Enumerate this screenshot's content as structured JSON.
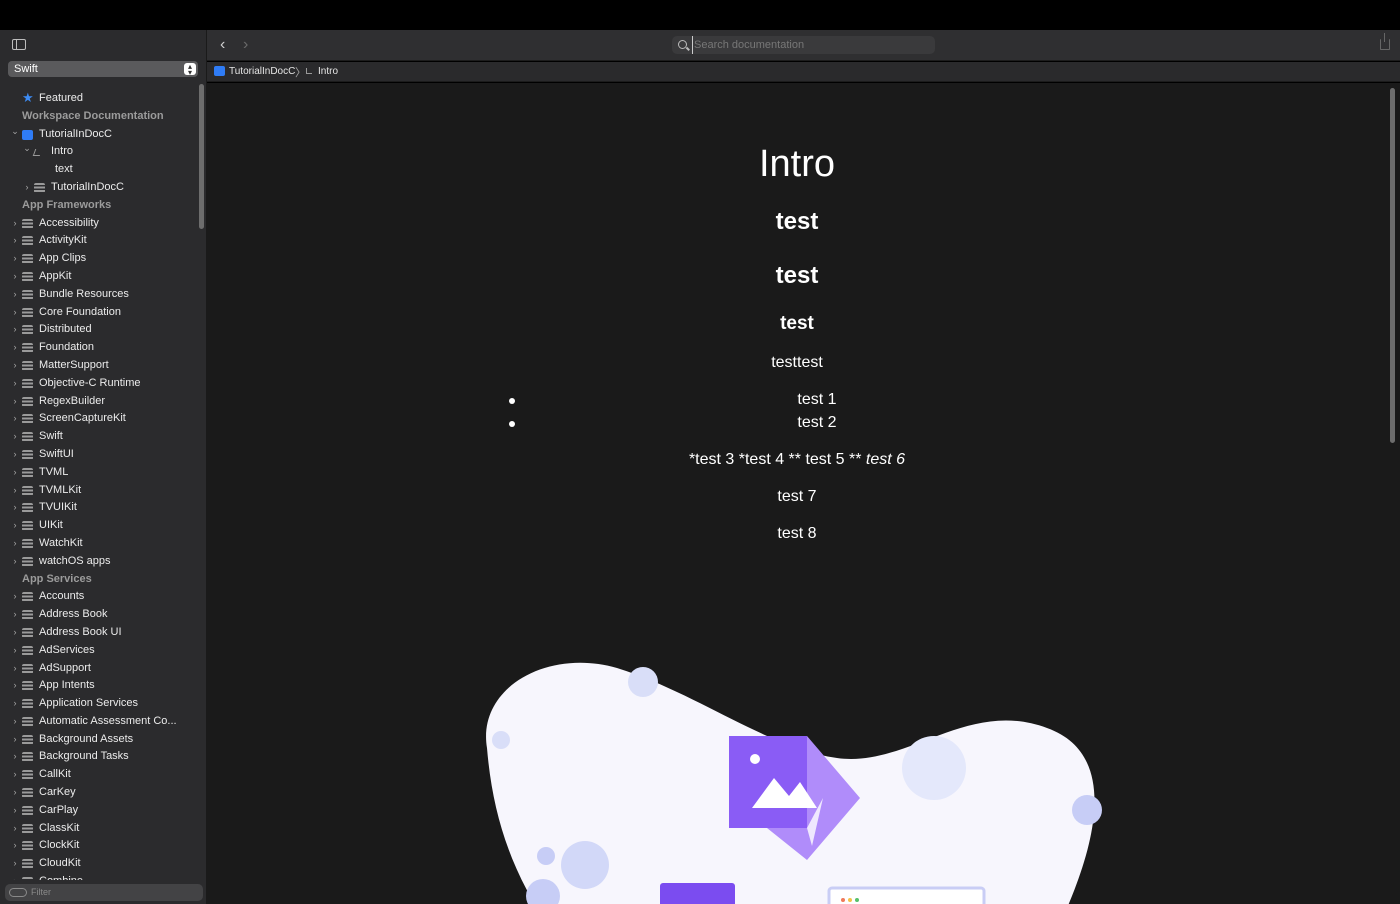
{
  "sidebar": {
    "language": "Swift",
    "filter_placeholder": "Filter",
    "items": [
      {
        "kind": "star",
        "label": "Featured",
        "depth": 0,
        "chevron": ""
      },
      {
        "kind": "section",
        "label": "Workspace Documentation"
      },
      {
        "kind": "project",
        "label": "TutorialInDocC",
        "depth": 0,
        "chevron": "open"
      },
      {
        "kind": "tutorial",
        "label": "Intro",
        "depth": 1,
        "chevron": "open"
      },
      {
        "kind": "text",
        "label": "text",
        "depth": 2,
        "chevron": ""
      },
      {
        "kind": "stack",
        "label": "TutorialInDocC",
        "depth": 1,
        "chevron": "closed"
      },
      {
        "kind": "section",
        "label": "App Frameworks"
      },
      {
        "kind": "stack",
        "label": "Accessibility",
        "depth": 0,
        "chevron": "closed"
      },
      {
        "kind": "stack",
        "label": "ActivityKit",
        "depth": 0,
        "chevron": "closed"
      },
      {
        "kind": "stack",
        "label": "App Clips",
        "depth": 0,
        "chevron": "closed"
      },
      {
        "kind": "stack",
        "label": "AppKit",
        "depth": 0,
        "chevron": "closed"
      },
      {
        "kind": "stack",
        "label": "Bundle Resources",
        "depth": 0,
        "chevron": "closed"
      },
      {
        "kind": "stack",
        "label": "Core Foundation",
        "depth": 0,
        "chevron": "closed"
      },
      {
        "kind": "stack",
        "label": "Distributed",
        "depth": 0,
        "chevron": "closed"
      },
      {
        "kind": "stack",
        "label": "Foundation",
        "depth": 0,
        "chevron": "closed"
      },
      {
        "kind": "stack",
        "label": "MatterSupport",
        "depth": 0,
        "chevron": "closed"
      },
      {
        "kind": "stack",
        "label": "Objective-C Runtime",
        "depth": 0,
        "chevron": "closed"
      },
      {
        "kind": "stack",
        "label": "RegexBuilder",
        "depth": 0,
        "chevron": "closed"
      },
      {
        "kind": "stack",
        "label": "ScreenCaptureKit",
        "depth": 0,
        "chevron": "closed"
      },
      {
        "kind": "stack",
        "label": "Swift",
        "depth": 0,
        "chevron": "closed"
      },
      {
        "kind": "stack",
        "label": "SwiftUI",
        "depth": 0,
        "chevron": "closed"
      },
      {
        "kind": "stack",
        "label": "TVML",
        "depth": 0,
        "chevron": "closed"
      },
      {
        "kind": "stack",
        "label": "TVMLKit",
        "depth": 0,
        "chevron": "closed"
      },
      {
        "kind": "stack",
        "label": "TVUIKit",
        "depth": 0,
        "chevron": "closed"
      },
      {
        "kind": "stack",
        "label": "UIKit",
        "depth": 0,
        "chevron": "closed"
      },
      {
        "kind": "stack",
        "label": "WatchKit",
        "depth": 0,
        "chevron": "closed"
      },
      {
        "kind": "stack",
        "label": "watchOS apps",
        "depth": 0,
        "chevron": "closed"
      },
      {
        "kind": "section",
        "label": "App Services"
      },
      {
        "kind": "stack",
        "label": "Accounts",
        "depth": 0,
        "chevron": "closed"
      },
      {
        "kind": "stack",
        "label": "Address Book",
        "depth": 0,
        "chevron": "closed"
      },
      {
        "kind": "stack",
        "label": "Address Book UI",
        "depth": 0,
        "chevron": "closed"
      },
      {
        "kind": "stack",
        "label": "AdServices",
        "depth": 0,
        "chevron": "closed"
      },
      {
        "kind": "stack",
        "label": "AdSupport",
        "depth": 0,
        "chevron": "closed"
      },
      {
        "kind": "stack",
        "label": "App Intents",
        "depth": 0,
        "chevron": "closed"
      },
      {
        "kind": "stack",
        "label": "Application Services",
        "depth": 0,
        "chevron": "closed"
      },
      {
        "kind": "stack",
        "label": "Automatic Assessment Co...",
        "depth": 0,
        "chevron": "closed"
      },
      {
        "kind": "stack",
        "label": "Background Assets",
        "depth": 0,
        "chevron": "closed"
      },
      {
        "kind": "stack",
        "label": "Background Tasks",
        "depth": 0,
        "chevron": "closed"
      },
      {
        "kind": "stack",
        "label": "CallKit",
        "depth": 0,
        "chevron": "closed"
      },
      {
        "kind": "stack",
        "label": "CarKey",
        "depth": 0,
        "chevron": "closed"
      },
      {
        "kind": "stack",
        "label": "CarPlay",
        "depth": 0,
        "chevron": "closed"
      },
      {
        "kind": "stack",
        "label": "ClassKit",
        "depth": 0,
        "chevron": "closed"
      },
      {
        "kind": "stack",
        "label": "ClockKit",
        "depth": 0,
        "chevron": "closed"
      },
      {
        "kind": "stack",
        "label": "CloudKit",
        "depth": 0,
        "chevron": "closed"
      },
      {
        "kind": "stack",
        "label": "Combine",
        "depth": 0,
        "chevron": "closed"
      }
    ]
  },
  "toolbar": {
    "search_placeholder": "Search documentation"
  },
  "breadcrumb": {
    "project": "TutorialInDocC",
    "page": "Intro"
  },
  "content": {
    "title": "Intro",
    "heading1": "test",
    "heading2": "test",
    "heading3": "test",
    "paragraph1": "testtest",
    "list": [
      "test 1",
      "test 2"
    ],
    "paragraph2_plain": "*test 3 *test 4 ** test 5 ** ",
    "paragraph2_italic": "test 6",
    "paragraph3": "test 7",
    "paragraph4": "test 8"
  },
  "colors": {
    "accent": "#2f7cf6",
    "illustration_blob": "#f7f6fd",
    "illustration_bubble": "#d9def8",
    "illustration_purple": "#7b4cf0"
  }
}
